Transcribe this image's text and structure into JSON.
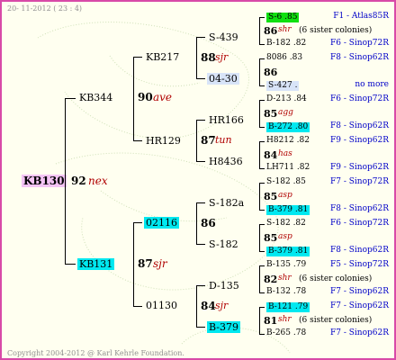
{
  "header": {
    "date": "20- 11-2012 ( 23 : 4)"
  },
  "footer": {
    "copyright": "Copyright 2004-2012 @ Karl Kehrle Foundation."
  },
  "root": {
    "id": "KB130",
    "score": "92",
    "breed": "nex"
  },
  "gen1": {
    "upper": {
      "id": "KB344"
    },
    "lower": {
      "id": "KB131",
      "score": "87",
      "breed": "sjr"
    },
    "upper_score": "90",
    "upper_breed": "ave"
  },
  "gen2": {
    "a": {
      "id": "KB217",
      "score": "88",
      "breed": "sjr"
    },
    "b": {
      "id": "HR129",
      "score": "87",
      "breed": "tun"
    },
    "c": {
      "id": "02116",
      "score": "86"
    },
    "d": {
      "id": "01130",
      "score": "84",
      "breed": "sjr"
    }
  },
  "gen3": {
    "a1": "S-439",
    "a2": "04-30",
    "b1": "HR166",
    "b2": "H8436",
    "c1": "S-182a",
    "c2": "S-182",
    "d1": "D-135",
    "d2": "B-379"
  },
  "gen4": [
    {
      "l1": "S-6 .85",
      "score": "86",
      "breed": "shr",
      "note": "(6 sister colonies)",
      "l3": "B-182 .82",
      "r1": "F1 - Atlas85R",
      "r2": "",
      "r3": "F6 - Sinop72R"
    },
    {
      "l1": "8086 .83",
      "score": "86",
      "breed": "",
      "note": "",
      "l3": "S-427 .",
      "r1": "F8 - Sinop62R",
      "r2": "",
      "r3": "no more"
    },
    {
      "l1": "D-213 .84",
      "score": "85",
      "breed": "agg",
      "note": "",
      "l3": "B-272 .80",
      "r1": "F6 - Sinop72R",
      "r2": "",
      "r3": "F8 - Sinop62R"
    },
    {
      "l1": "H8212 .82",
      "score": "84",
      "breed": "has",
      "note": "",
      "l3": "LH711 .82",
      "r1": "F9 - Sinop62R",
      "r2": "",
      "r3": "F9 - Sinop62R"
    },
    {
      "l1": "S-182 .85",
      "score": "85",
      "breed": "asp",
      "note": "",
      "l3": "B-379 .81",
      "r1": "F7 - Sinop72R",
      "r2": "",
      "r3": "F8 - Sinop62R"
    },
    {
      "l1": "S-182 .82",
      "score": "85",
      "breed": "asp",
      "note": "",
      "l3": "B-379 .81",
      "r1": "F6 - Sinop72R",
      "r2": "",
      "r3": "F8 - Sinop62R"
    },
    {
      "l1": "B-135 .79",
      "score": "82",
      "breed": "shr",
      "note": "(6 sister colonies)",
      "l3": "B-132 .78",
      "r1": "F5 - Sinop72R",
      "r2": "",
      "r3": "F7 - Sinop62R"
    },
    {
      "l1": "B-121 .79",
      "score": "81",
      "breed": "shr",
      "note": "(6 sister colonies)",
      "l3": "B-265 .78",
      "r1": "F7 - Sinop62R",
      "r2": "",
      "r3": "F7 - Sinop62R"
    }
  ]
}
